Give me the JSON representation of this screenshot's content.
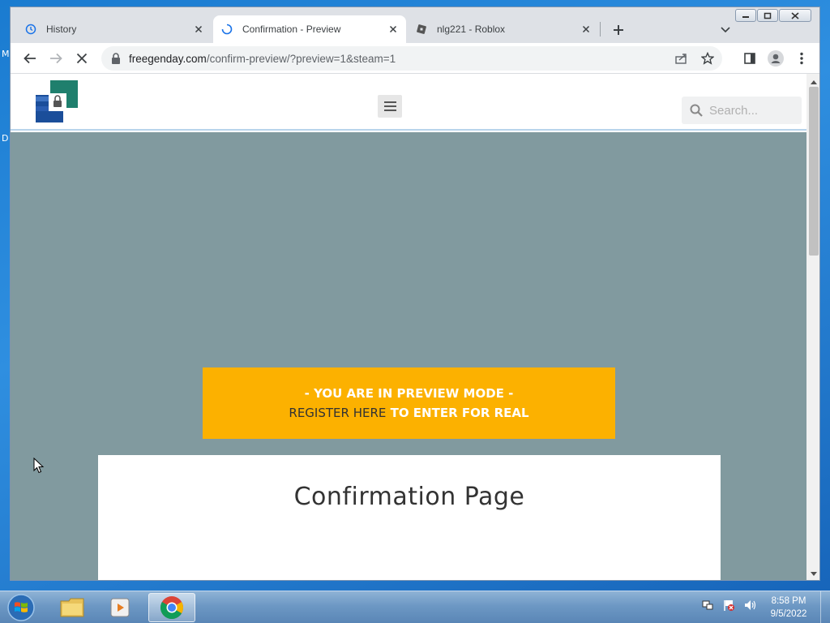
{
  "desktop": {
    "frag_m": "M",
    "frag_d": "D"
  },
  "browser": {
    "tabs": [
      {
        "title": "History"
      },
      {
        "title": "Confirmation - Preview"
      },
      {
        "title": "nlg221 - Roblox"
      }
    ],
    "url": {
      "host": "freegenday.com",
      "path": "/confirm-preview/?preview=1&steam=1"
    }
  },
  "site": {
    "search_placeholder": "Search...",
    "banner": {
      "line1": "- YOU ARE IN PREVIEW MODE -",
      "register_link": "REGISTER HERE",
      "rest": " TO ENTER FOR REAL"
    },
    "confirmation_title": "Confirmation Page"
  },
  "taskbar": {
    "time": "8:58 PM",
    "date": "9/5/2022"
  },
  "colors": {
    "banner": "#fcb100",
    "hero": "#819a9f",
    "taskbar": "#6d98c4"
  }
}
